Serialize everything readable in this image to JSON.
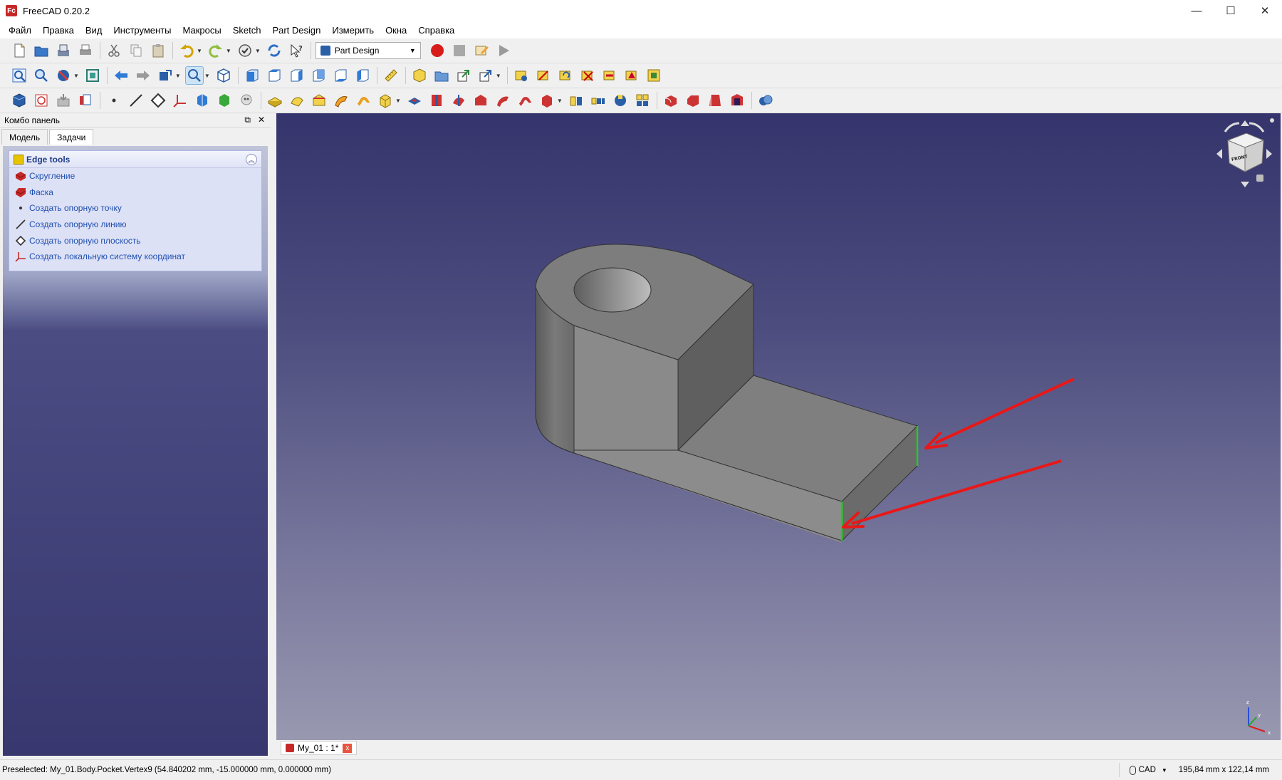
{
  "window": {
    "title": "FreeCAD 0.20.2",
    "logo_text": "Fc"
  },
  "window_controls": {
    "minimize": "—",
    "maximize": "☐",
    "close": "✕"
  },
  "menu": [
    "Файл",
    "Правка",
    "Вид",
    "Инструменты",
    "Макросы",
    "Sketch",
    "Part Design",
    "Измерить",
    "Окна",
    "Справка"
  ],
  "toolbar1": {
    "workbench": "Part Design"
  },
  "combo_panel": {
    "title": "Комбо панель",
    "tabs": [
      "Модель",
      "Задачи"
    ],
    "active_tab": "Задачи"
  },
  "edge_tools": {
    "title": "Edge tools",
    "items": [
      {
        "label": "Скругление",
        "icon": "fillet-icon"
      },
      {
        "label": "Фаска",
        "icon": "chamfer-icon"
      },
      {
        "label": "Создать опорную точку",
        "icon": "datum-point-icon"
      },
      {
        "label": "Создать опорную линию",
        "icon": "datum-line-icon"
      },
      {
        "label": "Создать опорную плоскость",
        "icon": "datum-plane-icon"
      },
      {
        "label": "Создать локальную систему координат",
        "icon": "local-cs-icon"
      }
    ]
  },
  "nav_cube": {
    "face_label": "FRONT"
  },
  "axis": {
    "x": "x",
    "y": "y",
    "z": "z"
  },
  "colors": {
    "selected_edge": "#22cc22",
    "arrow": "#e81818",
    "part": "#8c8c8c"
  },
  "document_tab": {
    "label": "My_01 : 1*",
    "close": "x"
  },
  "status": {
    "message": "Preselected: My_01.Body.Pocket.Vertex9 (54.840202 mm, -15.000000 mm, 0.000000 mm)",
    "nav_style": "CAD",
    "dimensions": "195,84 mm x 122,14 mm"
  }
}
